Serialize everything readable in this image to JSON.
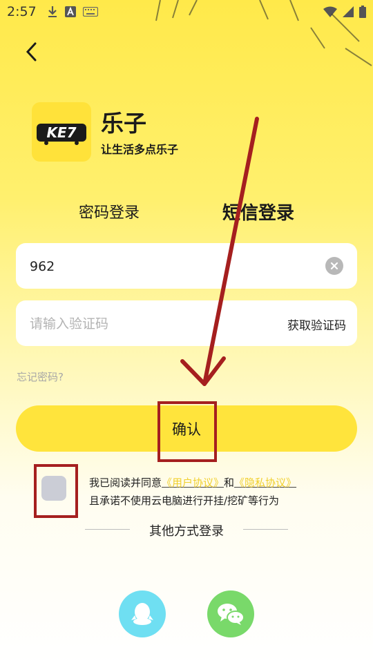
{
  "status_bar": {
    "time": "2:57"
  },
  "app": {
    "name": "乐子",
    "slogan": "让生活多点乐子",
    "logo_text": "KE7"
  },
  "tabs": [
    {
      "label": "密码登录",
      "active": false
    },
    {
      "label": "短信登录",
      "active": true
    }
  ],
  "phone_field": {
    "value": "962",
    "placeholder": ""
  },
  "code_field": {
    "value": "",
    "placeholder": "请输入验证码",
    "get_code_label": "获取验证码"
  },
  "forgot_password": "忘记密码?",
  "confirm_label": "确认",
  "agreement": {
    "prefix": "我已阅读并同意",
    "user_agreement": "《用户协议》",
    "and": "和",
    "privacy_policy": "《隐私协议》",
    "line2": "且承诺不使用云电脑进行开挂/挖矿等行为",
    "checked": false
  },
  "other_login": {
    "label": "其他方式登录",
    "options": [
      "qq-icon",
      "wechat-icon"
    ]
  },
  "colors": {
    "brand_yellow": "#ffe43c",
    "link": "#f0cf2c",
    "annotation": "#a51f1f"
  }
}
